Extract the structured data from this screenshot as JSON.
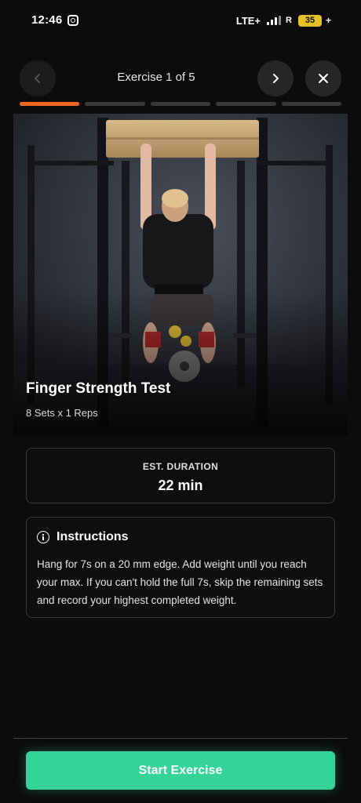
{
  "status_bar": {
    "time": "12:46",
    "network": "LTE+",
    "roaming": "R",
    "battery": "35",
    "battery_suffix": "+"
  },
  "nav": {
    "title": "Exercise 1 of 5",
    "prev_icon": "chevron-left-icon",
    "next_icon": "chevron-right-icon",
    "close_icon": "close-icon",
    "progress_segments": 5,
    "active_segment": 1
  },
  "exercise": {
    "name": "Finger Strength Test",
    "sets_reps": "8 Sets x 1 Reps"
  },
  "duration": {
    "label": "EST. DURATION",
    "value": "22 min"
  },
  "instructions": {
    "title": "Instructions",
    "text": "Hang for 7s on a 20 mm edge. Add weight until you reach your max. If you can't hold the full 7s, skip the remaining sets and record your highest completed weight."
  },
  "start_button": {
    "label": "Start Exercise"
  },
  "colors": {
    "accent_orange": "#f2691e",
    "accent_green": "#34d39a",
    "background": "#0c0c0d",
    "card_border": "#3a3a3c"
  }
}
